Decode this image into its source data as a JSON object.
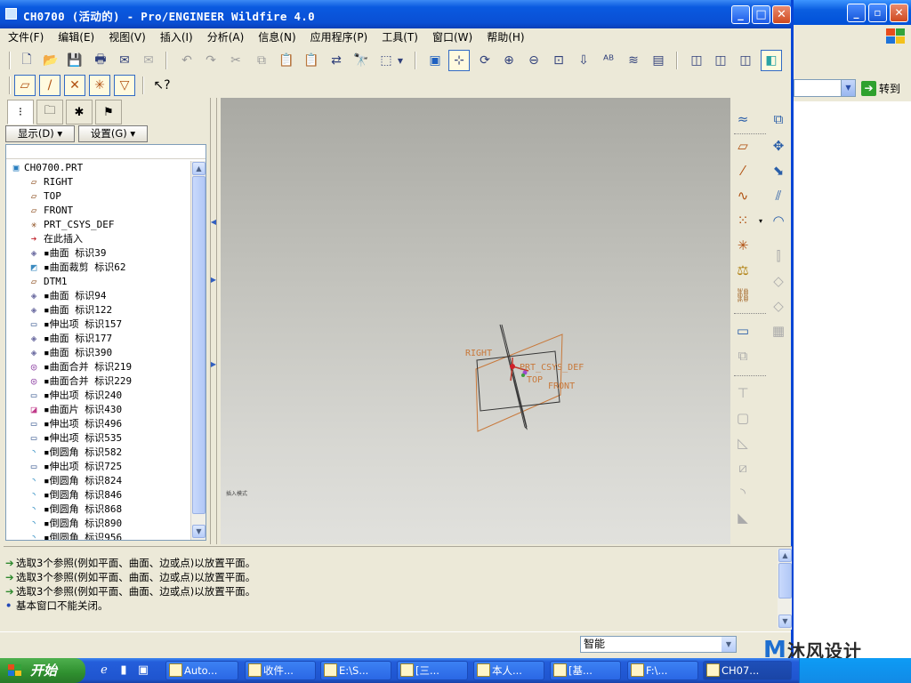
{
  "window": {
    "title": "CH0700 (活动的) - Pro/ENGINEER Wildfire 4.0",
    "minimize": "_",
    "maximize": "□",
    "close": "✕"
  },
  "menu": [
    "文件(F)",
    "编辑(E)",
    "视图(V)",
    "插入(I)",
    "分析(A)",
    "信息(N)",
    "应用程序(P)",
    "工具(T)",
    "窗口(W)",
    "帮助(H)"
  ],
  "model_tree": {
    "show_button": "显示(D)",
    "settings_button": "设置(G)",
    "items": [
      {
        "icon": "part-icon",
        "label": "CH0700.PRT",
        "level": 0
      },
      {
        "icon": "datum-plane-icon",
        "label": "RIGHT",
        "level": 1
      },
      {
        "icon": "datum-plane-icon",
        "label": "TOP",
        "level": 1
      },
      {
        "icon": "datum-plane-icon",
        "label": "FRONT",
        "level": 1
      },
      {
        "icon": "coordinate-system-icon",
        "label": "PRT_CSYS_DEF",
        "level": 1
      },
      {
        "icon": "insert-here-arrow-icon",
        "label": "在此插入",
        "level": 1
      },
      {
        "icon": "surface-icon",
        "label": "▪曲面 标识39",
        "level": 1
      },
      {
        "icon": "surface-trim-icon",
        "label": "▪曲面裁剪 标识62",
        "level": 1
      },
      {
        "icon": "datum-plane-icon",
        "label": "DTM1",
        "level": 1
      },
      {
        "icon": "surface-icon",
        "label": "▪曲面 标识94",
        "level": 1
      },
      {
        "icon": "surface-icon",
        "label": "▪曲面 标识122",
        "level": 1
      },
      {
        "icon": "extrude-icon",
        "label": "▪伸出项 标识157",
        "level": 1
      },
      {
        "icon": "surface-icon",
        "label": "▪曲面 标识177",
        "level": 1
      },
      {
        "icon": "surface-icon",
        "label": "▪曲面 标识390",
        "level": 1
      },
      {
        "icon": "surface-merge-icon",
        "label": "▪曲面合并 标识219",
        "level": 1
      },
      {
        "icon": "surface-merge-icon",
        "label": "▪曲面合并 标识229",
        "level": 1
      },
      {
        "icon": "extrude-icon",
        "label": "▪伸出项 标识240",
        "level": 1
      },
      {
        "icon": "surface-patch-icon",
        "label": "▪曲面片 标识430",
        "level": 1
      },
      {
        "icon": "extrude-icon",
        "label": "▪伸出项 标识496",
        "level": 1
      },
      {
        "icon": "extrude-icon",
        "label": "▪伸出项 标识535",
        "level": 1
      },
      {
        "icon": "round-icon",
        "label": "▪倒圆角 标识582",
        "level": 1
      },
      {
        "icon": "extrude-icon",
        "label": "▪伸出项 标识725",
        "level": 1
      },
      {
        "icon": "round-icon",
        "label": "▪倒圆角 标识824",
        "level": 1
      },
      {
        "icon": "round-icon",
        "label": "▪倒圆角 标识846",
        "level": 1
      },
      {
        "icon": "round-icon",
        "label": "▪倒圆角 标识868",
        "level": 1
      },
      {
        "icon": "round-icon",
        "label": "▪倒圆角 标识890",
        "level": 1
      },
      {
        "icon": "round-icon",
        "label": "▪倒圆角 标识956",
        "level": 1
      }
    ]
  },
  "graphics": {
    "labels": {
      "right": "RIGHT",
      "csys": "PRT_CSYS_DEF",
      "top": "TOP",
      "front": "FRONT"
    },
    "corner_label": "插入模式"
  },
  "messages": [
    {
      "type": "prompt",
      "text": "选取3个参照(例如平面、曲面、边或点)以放置平面。"
    },
    {
      "type": "prompt",
      "text": "选取3个参照(例如平面、曲面、边或点)以放置平面。"
    },
    {
      "type": "prompt",
      "text": "选取3个参照(例如平面、曲面、边或点)以放置平面。"
    },
    {
      "type": "info",
      "text": "基本窗口不能关闭。"
    }
  ],
  "status": {
    "filter_value": "智能"
  },
  "background_window": {
    "goto_label": "转到"
  },
  "taskbar": {
    "start_label": "开始",
    "tasks": [
      "Auto...",
      "收件...",
      "E:\\S...",
      "[三...",
      "本人...",
      "[基...",
      "F:\\...",
      "CH07..."
    ]
  },
  "watermark": "沐风设计",
  "colors": {
    "accent": "#0a5ae0",
    "datum": "#c8783a",
    "graphics_top": "#a9a9a3",
    "graphics_bottom": "#e1e1dd"
  }
}
